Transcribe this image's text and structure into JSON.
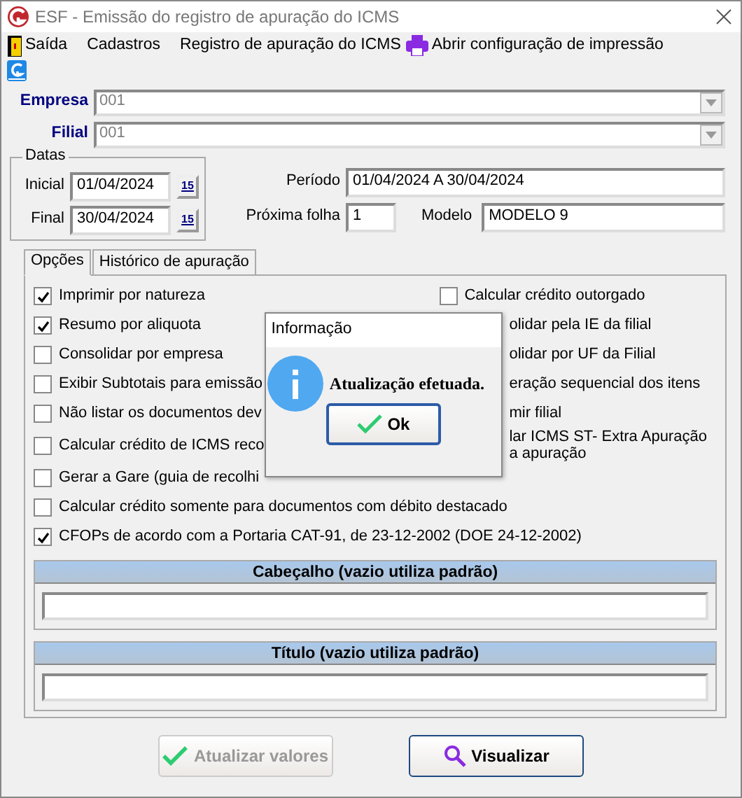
{
  "window": {
    "title": "ESF - Emissão do registro de apuração do ICMS"
  },
  "menu": [
    {
      "label": "Saída"
    },
    {
      "label": "Cadastros"
    },
    {
      "label": "Registro de apuração do ICMS"
    },
    {
      "label": "Abrir configuração de impressão"
    }
  ],
  "empresa": {
    "label": "Empresa",
    "value": "001",
    "disabled": true
  },
  "filial": {
    "label": "Filial",
    "value": "001",
    "disabled": true
  },
  "datas": {
    "legend": "Datas",
    "inicial_label": "Inicial",
    "inicial": "01/04/2024",
    "inicial_glyph": "15",
    "final_label": "Final",
    "final": "30/04/2024",
    "final_glyph": "15"
  },
  "periodo": {
    "label": "Período",
    "value": "01/04/2024 A 30/04/2024"
  },
  "proxima_folha": {
    "label": "Próxima folha",
    "value": "1"
  },
  "modelo": {
    "label": "Modelo",
    "value": "MODELO 9"
  },
  "tabs": [
    {
      "label": "Opções",
      "selected": true
    },
    {
      "label": "Histórico de apuração",
      "selected": false
    }
  ],
  "options_left": [
    {
      "label": "Imprimir por natureza",
      "checked": true
    },
    {
      "label": "Resumo por aliquota",
      "checked": true
    },
    {
      "label": "Consolidar por empresa",
      "checked": false
    },
    {
      "label": "Exibir Subtotais para emissão",
      "checked": false
    },
    {
      "label": "Não listar os documentos dev",
      "checked": false
    },
    {
      "label": "Calcular crédito de ICMS reco",
      "checked": false
    },
    {
      "label": "Gerar a Gare (guia de recolhi",
      "checked": false
    }
  ],
  "options_right": [
    {
      "kind": "checkbox",
      "label": "Calcular crédito outorgado",
      "checked": false
    },
    {
      "kind": "partial",
      "label": "olidar pela IE da filial"
    },
    {
      "kind": "partial",
      "label": "olidar por UF da Filial"
    },
    {
      "kind": "partial",
      "label": "eração sequencial dos itens"
    },
    {
      "kind": "partial",
      "label": "mir filial"
    },
    {
      "kind": "partial",
      "label": "lar ICMS ST- Extra Apuração",
      "label_2": "a apuração"
    }
  ],
  "options_wide": [
    {
      "label": "Calcular crédito somente para documentos com débito destacado",
      "checked": false
    },
    {
      "label": "CFOPs de acordo com a Portaria CAT-91, de 23-12-2002 (DOE 24-12-2002)",
      "checked": true
    }
  ],
  "sections": [
    {
      "title": "Cabeçalho (vazio utiliza padrão)"
    },
    {
      "title": "Título (vazio utiliza padrão)"
    }
  ],
  "buttons": [
    {
      "label": "Atualizar valores",
      "disabled": true
    },
    {
      "label": "Visualizar",
      "disabled": false
    }
  ],
  "dialog": {
    "title": "Informação",
    "message": "Atualização efetuada.",
    "button": "Ok"
  }
}
